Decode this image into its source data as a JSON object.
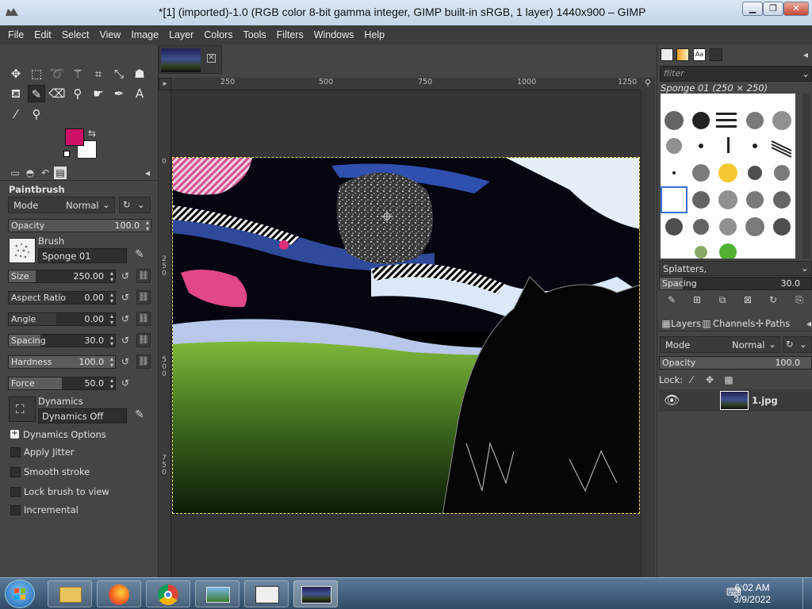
{
  "window": {
    "title": "*[1] (imported)-1.0 (RGB color 8-bit gamma integer, GIMP built-in sRGB, 1 layer) 1440x900 – GIMP"
  },
  "menu": [
    "File",
    "Edit",
    "Select",
    "View",
    "Image",
    "Layer",
    "Colors",
    "Tools",
    "Filters",
    "Windows",
    "Help"
  ],
  "colors": {
    "foreground": "#cc1166",
    "background": "#ffffff"
  },
  "tool_options": {
    "title": "Paintbrush",
    "mode_label": "Mode",
    "mode_value": "Normal",
    "opacity_label": "Opacity",
    "opacity_value": "100.0",
    "brush_label": "Brush",
    "brush_value": "Sponge 01",
    "size_label": "Size",
    "size_value": "250.00",
    "size_fill": 0.25,
    "aspect_label": "Aspect Ratio",
    "aspect_value": "0.00",
    "angle_label": "Angle",
    "angle_value": "0.00",
    "spacing_label": "Spacing",
    "spacing_value": "30.0",
    "spacing_fill": 0.3,
    "hardness_label": "Hardness",
    "hardness_value": "100.0",
    "force_label": "Force",
    "force_value": "50.0",
    "force_fill": 0.5,
    "dynamics_label": "Dynamics",
    "dynamics_value": "Dynamics Off",
    "dynamics_options": "Dynamics Options",
    "apply_jitter": "Apply Jitter",
    "smooth_stroke": "Smooth stroke",
    "lock_brush": "Lock brush to view",
    "incremental": "Incremental"
  },
  "ruler": {
    "top": [
      "250",
      "500",
      "750",
      "1000",
      "1250"
    ],
    "left": [
      "0",
      "2\n5\n0",
      "5\n0\n0",
      "7\n5\n0"
    ]
  },
  "brushes": {
    "filter_placeholder": "filter",
    "current": "Sponge 01 (250 × 250)",
    "tag_field": "Splatters,",
    "spacing_label": "Spacing",
    "spacing_value": "30.0"
  },
  "layers": {
    "tabs": [
      "Layers",
      "Channels",
      "Paths"
    ],
    "mode_label": "Mode",
    "mode_value": "Normal",
    "opacity_label": "Opacity",
    "opacity_value": "100.0",
    "lock_label": "Lock:",
    "layer_name": "1.jpg"
  },
  "taskbar": {
    "time": "6:02 AM",
    "date": "3/9/2022"
  }
}
